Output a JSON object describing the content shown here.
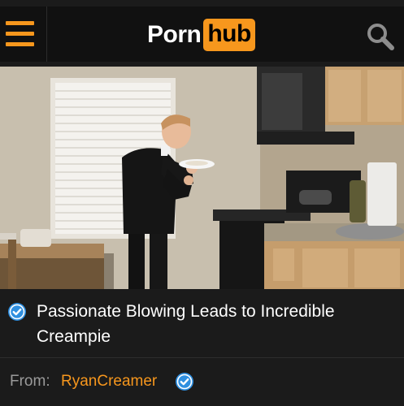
{
  "header": {
    "logo_left": "Porn",
    "logo_right": "hub",
    "menu_icon": "hamburger-menu-icon",
    "search_icon": "search-icon"
  },
  "video": {
    "title": "Passionate Blowing Leads to Incredible Creampie",
    "title_line1": "Passionate Blowing Leads to Incredible",
    "title_line2": "Creampie",
    "verified_icon": "verified-check-icon"
  },
  "uploader": {
    "from_label": "From:",
    "name": "RyanCreamer",
    "verified_icon": "verified-check-icon"
  },
  "colors": {
    "accent": "#f7971d",
    "header_bg": "#111111",
    "page_bg": "#1b1b1b",
    "verified_blue": "#2f8fe0",
    "muted_text": "#9a9a9a"
  }
}
